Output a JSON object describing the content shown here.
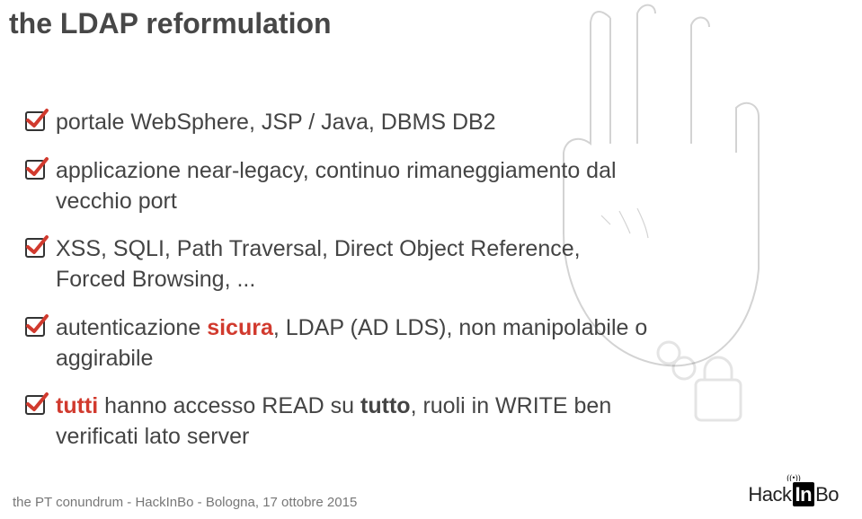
{
  "title": "the LDAP reformulation",
  "bullets": [
    {
      "html": "portale WebSphere, JSP / Java, DBMS DB2"
    },
    {
      "html": "applicazione near-legacy, continuo rimaneggiamento dal vecchio port"
    },
    {
      "html": "XSS, SQLI, Path Traversal, Direct Object Reference, Forced Browsing, ..."
    },
    {
      "html": "autenticazione <b class=\"red\">sicura</b>, LDAP (AD LDS), non manipolabile o aggirabile"
    },
    {
      "html": "<b class=\"red\">tutti</b> hanno accesso READ su <b>tutto</b>, ruoli in WRITE ben verificati lato server"
    }
  ],
  "footer": "the PT conundrum - HackInBo - Bologna, 17 ottobre 2015",
  "logo": {
    "hack": "Hack",
    "in": "In",
    "bo": "Bo"
  },
  "check_color": "#d13a2e"
}
